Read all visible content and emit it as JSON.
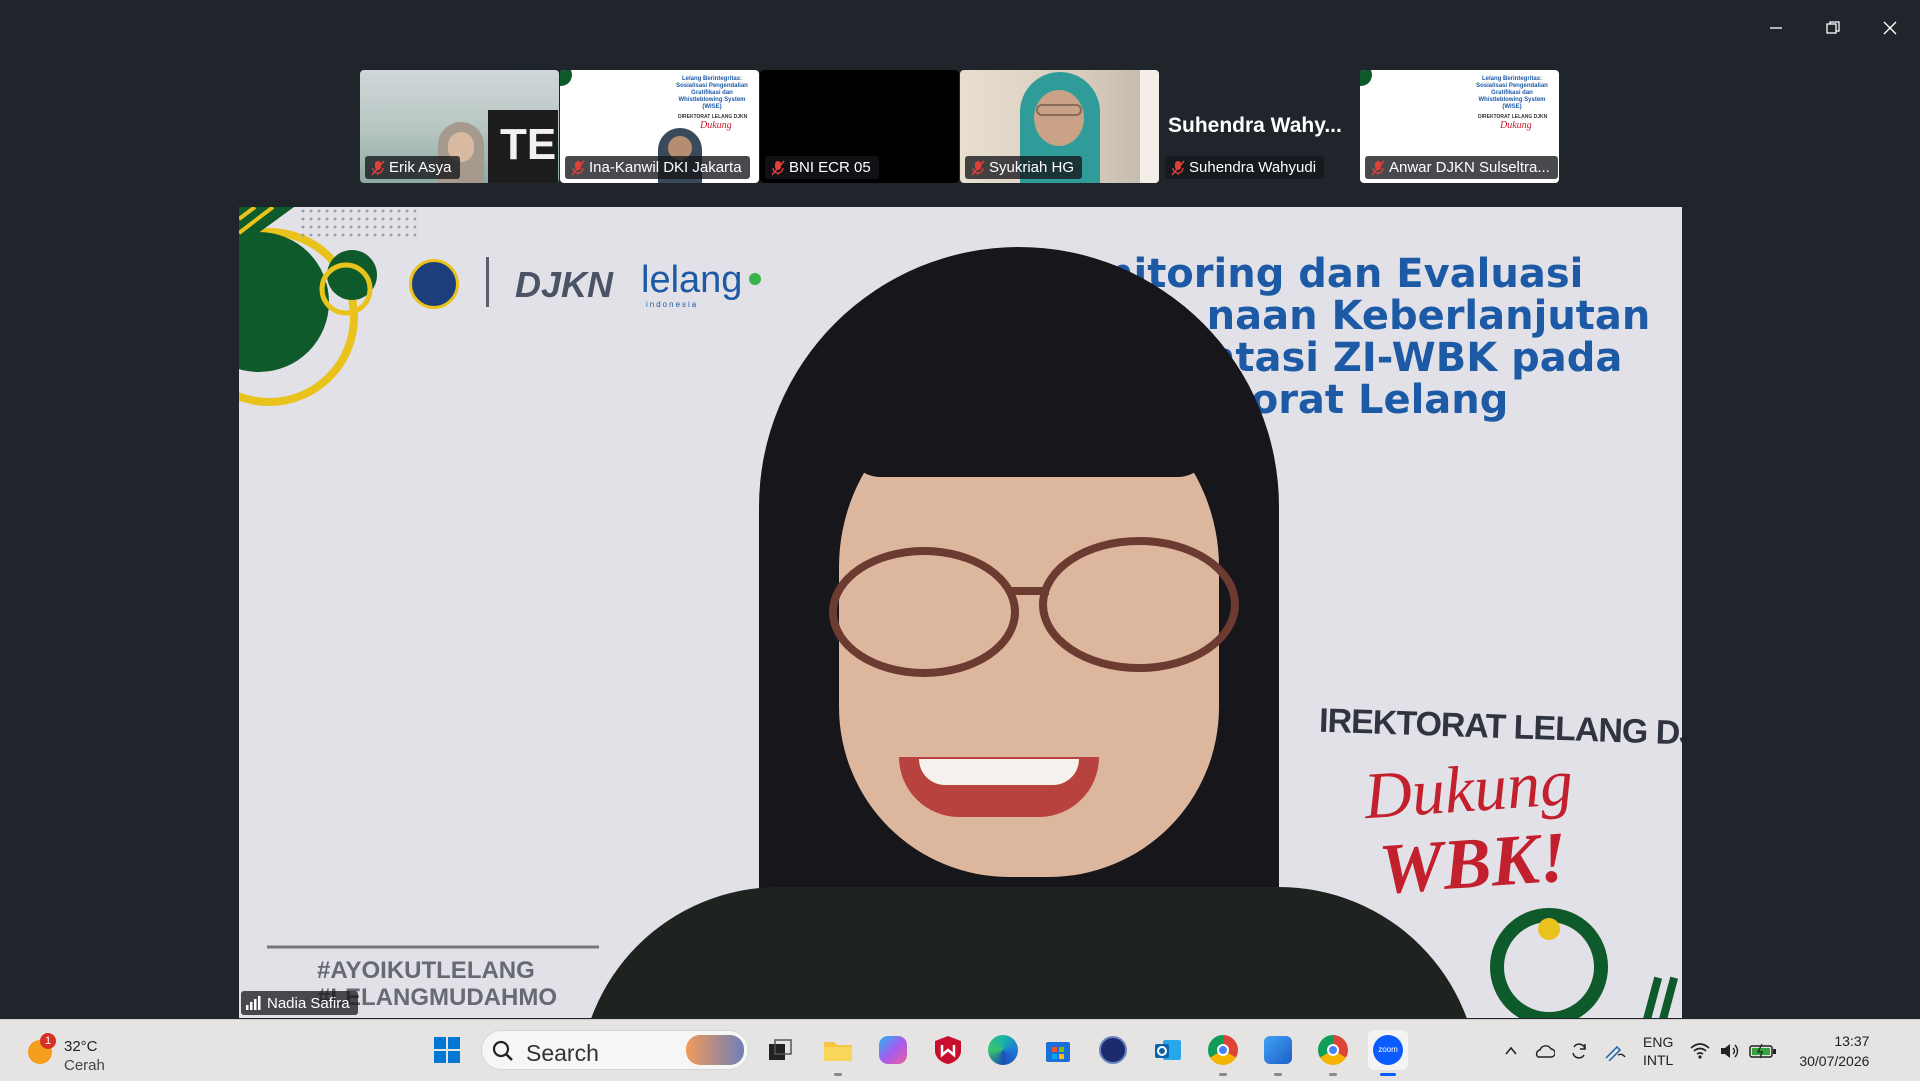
{
  "window": {
    "controls": [
      "minimize",
      "restore",
      "close"
    ]
  },
  "gallery": [
    {
      "name": "Erik Asya",
      "muted": true
    },
    {
      "name": "Ina-Kanwil DKI Jakarta",
      "muted": true
    },
    {
      "name": "BNI ECR 05",
      "muted": true
    },
    {
      "name": "Syukriah HG",
      "muted": true
    },
    {
      "name": "Suhendra Wahyudi",
      "display_name": "Suhendra  Wahy...",
      "muted": true
    },
    {
      "name": "Anwar DJKN Sulseltra...",
      "muted": true
    }
  ],
  "slide_thumb": {
    "title": "Lelang Berintegritas: Sosialisasi Pengendalian Gratifikasi dan Whistleblowing System (WISE)",
    "tag": "DIREKTORAT LELANG DJKN",
    "script": "Dukung"
  },
  "stage": {
    "speaker": "Nadia Safira",
    "logo_djkn": "DJKN",
    "logo_lelang": "lelang",
    "logo_lelang_sub": "indonesia",
    "title_lines": [
      "nitoring dan Evaluasi",
      "naan Keberlanjutan",
      "ntasi ZI-WBK pada",
      "torat Lelang"
    ],
    "tag_line": "IREKTORAT LELANG DJKN",
    "script_1": "Dukung",
    "script_2": "WBK!",
    "hashtag_1": "#AYOIKUTLELANG",
    "hashtag_2": "#LELANGMUDAHMO"
  },
  "taskbar": {
    "weather": {
      "temp": "32°C",
      "desc": "Cerah",
      "badge": "1"
    },
    "search_placeholder": "Search",
    "pinned": [
      "task-view",
      "file-explorer",
      "copilot",
      "mcafee",
      "edge",
      "microsoft-store",
      "dell",
      "outlook",
      "chrome",
      "photos",
      "chrome-profile",
      "zoom"
    ],
    "lang_1": "ENG",
    "lang_2": "INTL",
    "time": "13:37",
    "date": "30/07/2026"
  },
  "colors": {
    "slide_green": "#0f5a2a",
    "slide_yellow": "#e9c21b",
    "slide_blue": "#1c5aa6",
    "slide_red": "#c3202e",
    "zoom_blue": "#0b5cff",
    "mute_red": "#e0403a"
  }
}
